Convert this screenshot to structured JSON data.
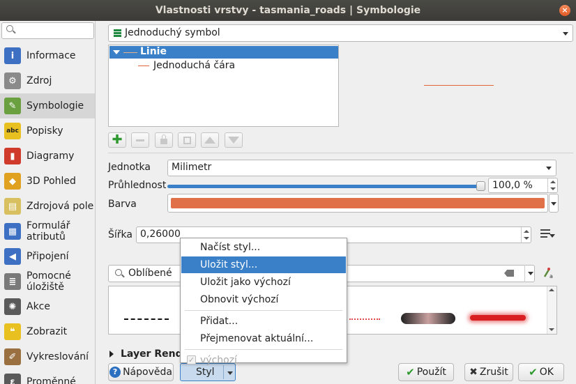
{
  "window": {
    "title": "Vlastnosti vrstvy - tasmania_roads | Symbologie",
    "close_glyph": "×"
  },
  "sidebar": {
    "search_placeholder": "",
    "items": [
      {
        "label": "Informace",
        "icon": "info-icon",
        "color": "#3d6fc2",
        "glyph": "i"
      },
      {
        "label": "Zdroj",
        "icon": "wrench-icon",
        "color": "#8a8a8a",
        "glyph": "⚙"
      },
      {
        "label": "Symbologie",
        "icon": "paintbrush-icon",
        "color": "#6aa040",
        "glyph": "✎",
        "active": true
      },
      {
        "label": "Popisky",
        "icon": "abc-label-icon",
        "color": "#e8c020",
        "glyph": "abc"
      },
      {
        "label": "Diagramy",
        "icon": "diagram-icon",
        "color": "#d03a2a",
        "glyph": "▮"
      },
      {
        "label": "3D Pohled",
        "icon": "cube-icon",
        "color": "#e0a020",
        "glyph": "◆"
      },
      {
        "label": "Zdrojová pole",
        "icon": "fields-icon",
        "color": "#d8c060",
        "glyph": "▤"
      },
      {
        "label": "Formulář atributů",
        "icon": "form-icon",
        "color": "#3d6fc2",
        "glyph": "▦"
      },
      {
        "label": "Připojení",
        "icon": "join-icon",
        "color": "#3d6fc2",
        "glyph": "◀"
      },
      {
        "label": "Pomocné úložiště",
        "icon": "storage-icon",
        "color": "#7a7a7a",
        "glyph": "≣"
      },
      {
        "label": "Akce",
        "icon": "gear-icon",
        "color": "#5a5a5a",
        "glyph": "✺"
      },
      {
        "label": "Zobrazit",
        "icon": "speech-bubble-icon",
        "color": "#e8c020",
        "glyph": "❝"
      },
      {
        "label": "Vykreslování",
        "icon": "brush-icon",
        "color": "#9a7040",
        "glyph": "✐"
      },
      {
        "label": "Proměnné",
        "icon": "variables-icon",
        "color": "#5a5a5a",
        "glyph": "ε"
      }
    ]
  },
  "renderer": {
    "selected": "Jednoduchý symbol"
  },
  "symbol_tree": {
    "root": "Linie",
    "child": "Jednoduchá čára"
  },
  "toolbar": {
    "add_glyph": "✚"
  },
  "properties": {
    "unit_label": "Jednotka",
    "unit_value": "Milimetr",
    "opacity_label": "Průhlednost",
    "opacity_value": "100,0 %",
    "opacity_fraction": 1.0,
    "color_label": "Barva",
    "color_value": "#e07048",
    "width_label": "Šířka",
    "width_value": "0,26000"
  },
  "library": {
    "search_value": "Oblíbené"
  },
  "layer_rendering": {
    "label": "Layer Rend"
  },
  "buttons": {
    "help": "Nápověda",
    "help_glyph": "?",
    "style": "Styl",
    "apply": "Použít",
    "apply_glyph": "✔",
    "cancel": "Zrušit",
    "cancel_glyph": "✖",
    "ok": "OK",
    "ok_glyph": "✔"
  },
  "style_menu": {
    "items": [
      {
        "label": "Načíst styl..."
      },
      {
        "label": "Uložit styl...",
        "highlighted": true
      },
      {
        "label": "Uložit jako výchozí"
      },
      {
        "label": "Obnovit výchozí"
      },
      {
        "label": "Přidat..."
      },
      {
        "label": "Přejmenovat aktuální..."
      },
      {
        "label": "výchozí",
        "disabled": true,
        "checked": true
      }
    ],
    "check_glyph": "✓"
  },
  "colors": {
    "accent": "#3a80c9",
    "symbol_line": "#e0663a"
  }
}
